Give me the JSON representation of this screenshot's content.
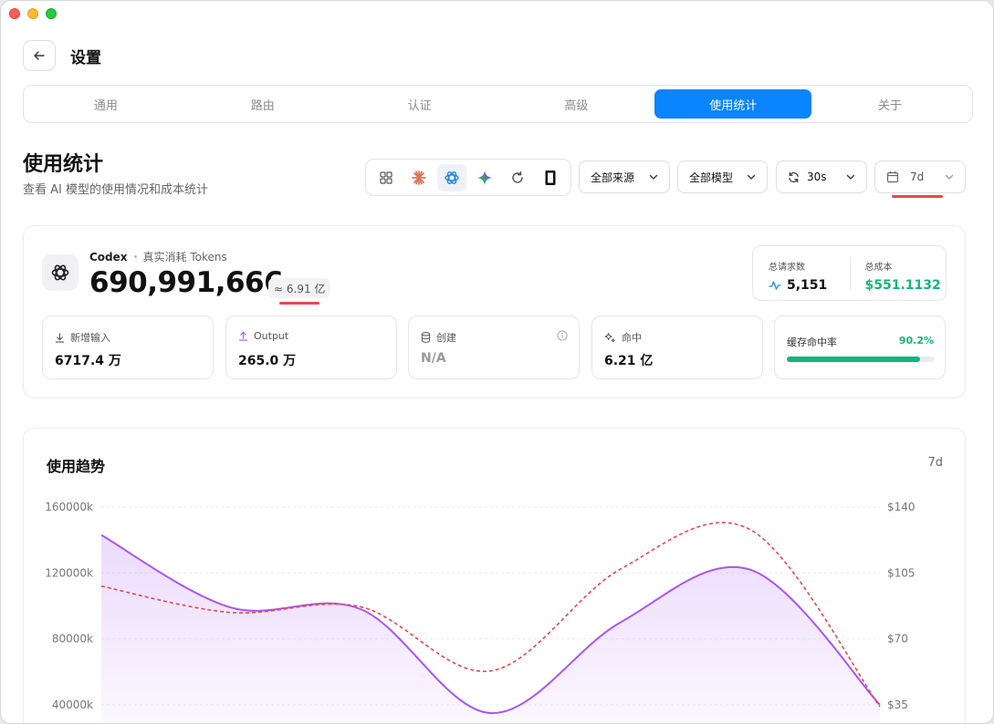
{
  "header": {
    "title": "设置"
  },
  "tabs": [
    {
      "label": "通用"
    },
    {
      "label": "路由"
    },
    {
      "label": "认证"
    },
    {
      "label": "高级"
    },
    {
      "label": "使用统计",
      "active": true
    },
    {
      "label": "关于"
    }
  ],
  "page": {
    "title": "使用统计",
    "subtitle": "查看 AI 模型的使用情况和成本统计"
  },
  "source_filter_icons": [
    {
      "icon": "grid-all-icon"
    },
    {
      "icon": "claude-starburst-icon"
    },
    {
      "icon": "openai-logo-icon",
      "active": true
    },
    {
      "icon": "gemini-sparkle-icon"
    },
    {
      "icon": "refresh-loop-icon"
    },
    {
      "icon": "device-icon"
    }
  ],
  "filters": {
    "source": "全部来源",
    "model": "全部模型",
    "refresh": "30s",
    "range": "7d"
  },
  "summary": {
    "provider": "Codex",
    "desc": "真实消耗 Tokens",
    "tokens": "690,991,666",
    "approx": "≈ 6.91 亿",
    "total_requests_label": "总请求数",
    "total_requests": "5,151",
    "total_cost_label": "总成本",
    "total_cost": "$551.1132",
    "metrics": {
      "input_label": "新增输入",
      "input_val": "6717.4 万",
      "output_label": "Output",
      "output_val": "265.0 万",
      "create_label": "创建",
      "create_val": "N/A",
      "hit_label": "命中",
      "hit_val": "6.21 亿",
      "cache_rate_label": "缓存命中率",
      "cache_rate": "90.2%",
      "cache_rate_fraction": 0.902
    }
  },
  "colors": {
    "accent": "#0a84ff",
    "green": "#16b47a",
    "token_line": "#a855f7",
    "cost_line": "#e5484d"
  },
  "chart_data": {
    "type": "area",
    "title": "使用趋势",
    "range_label": "7d",
    "y_left_ticks": [
      "160000k",
      "120000k",
      "80000k",
      "40000k"
    ],
    "y_right_ticks": [
      "$140",
      "$105",
      "$70",
      "$35"
    ],
    "y_left_range": [
      40000,
      160000
    ],
    "y_right_range": [
      35,
      140
    ],
    "series": [
      {
        "values": [
          143000,
          99000,
          98000,
          35000,
          90000,
          122000,
          40000
        ]
      },
      {
        "values": [
          98,
          84,
          87,
          53,
          107,
          128,
          34
        ]
      }
    ]
  }
}
